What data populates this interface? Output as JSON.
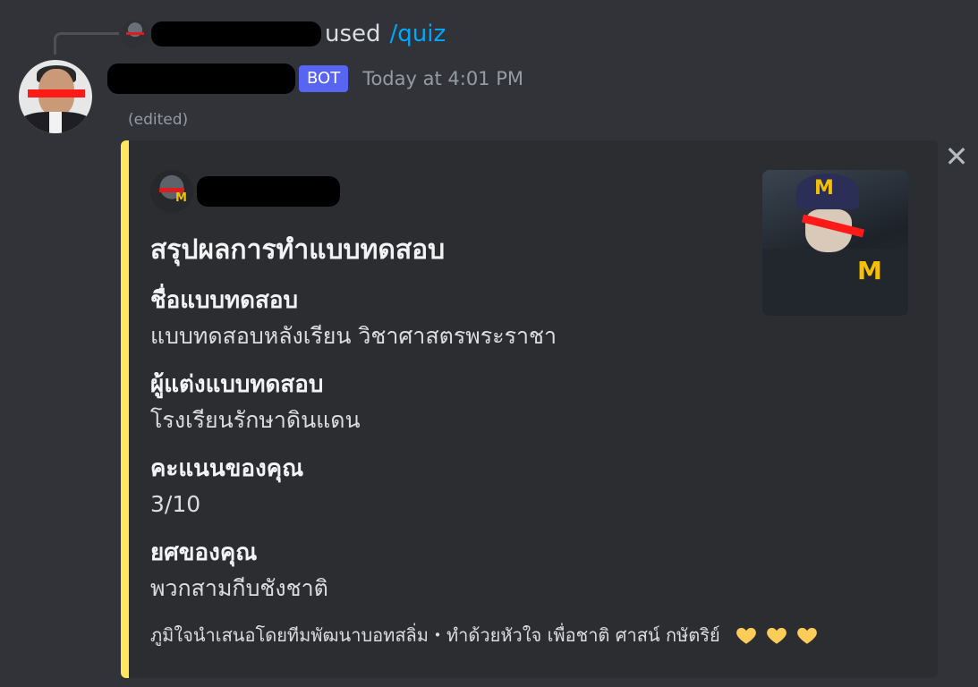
{
  "reply": {
    "used_text": "used",
    "command": "/quiz"
  },
  "message": {
    "badge": "BOT",
    "timestamp": "Today at 4:01 PM",
    "edited": "(edited)"
  },
  "embed": {
    "accent_color": "#fee75c",
    "title": "สรุปผลการทำแบบทดสอบ",
    "fields": [
      {
        "name": "ชื่อแบบทดสอบ",
        "value": "แบบทดสอบหลังเรียน วิชาศาสตรพระราชา"
      },
      {
        "name": "ผู้แต่งแบบทดสอบ",
        "value": "โรงเรียนรักษาดินแดน"
      },
      {
        "name": "คะแนนของคุณ",
        "value": "3/10"
      },
      {
        "name": "ยศของคุณ",
        "value": "พวกสามกีบชังชาติ"
      }
    ],
    "footer": "ภูมิใจนำเสนอโดยทีมพัฒนาบอทสลิ่ม・ทำด้วยหัวใจ เพื่อชาติ ศาสน์ กษัตริย์",
    "footer_icons": [
      "yellow-heart-icon",
      "yellow-heart-icon",
      "yellow-heart-icon"
    ]
  },
  "colors": {
    "background": "#313338",
    "embed_background": "#2b2d31",
    "command_link": "#00a8fc",
    "bot_badge": "#5865f2"
  }
}
